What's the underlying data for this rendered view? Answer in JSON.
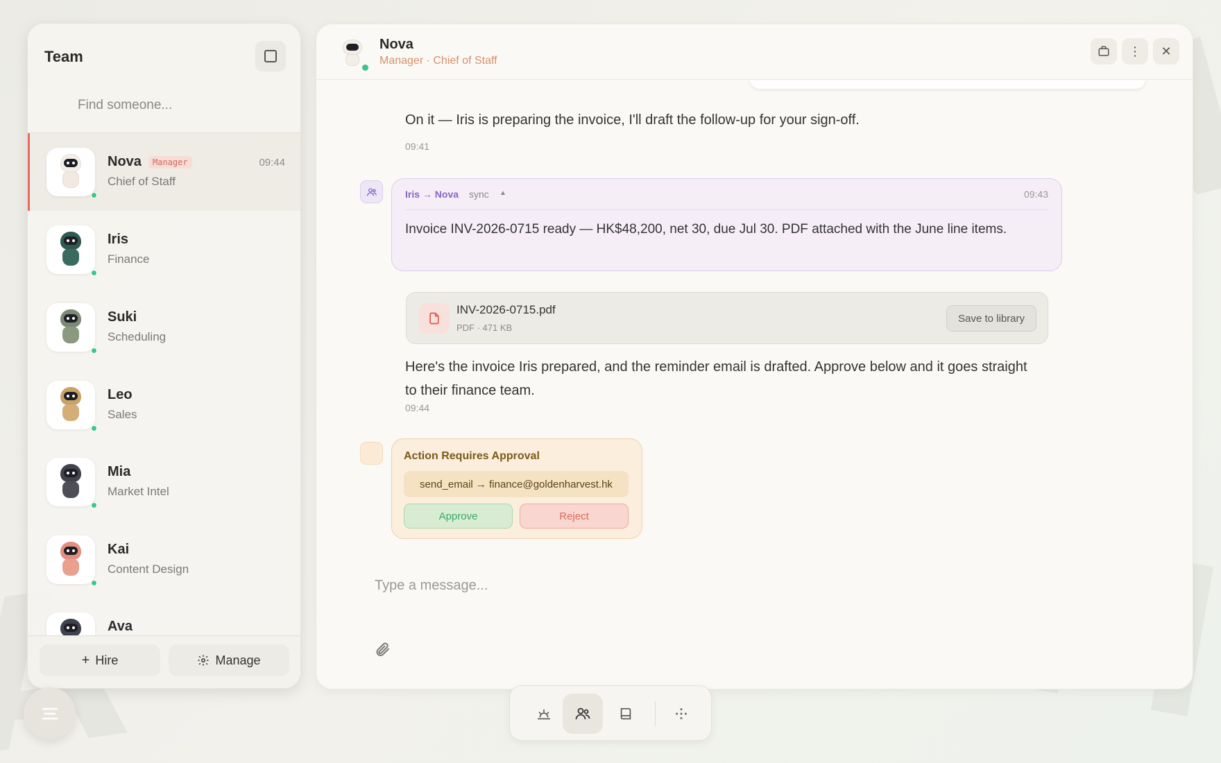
{
  "sidebar": {
    "title": "Team",
    "search_placeholder": "Find someone...",
    "members": [
      {
        "name": "Nova",
        "role": "Chief of Staff",
        "badge": "Manager",
        "time": "09:44",
        "head": "#f4efe9",
        "body": "#f1e9e2",
        "active": true
      },
      {
        "name": "Iris",
        "role": "Finance",
        "head": "#2f5a4f",
        "body": "#3b6a5e"
      },
      {
        "name": "Suki",
        "role": "Scheduling",
        "head": "#7b8a74",
        "body": "#8a997f"
      },
      {
        "name": "Leo",
        "role": "Sales",
        "head": "#c9a268",
        "body": "#d3ae77"
      },
      {
        "name": "Mia",
        "role": "Market Intel",
        "head": "#42424c",
        "body": "#4e4e58"
      },
      {
        "name": "Kai",
        "role": "Content Design",
        "head": "#e38f7f",
        "body": "#e9a08f"
      },
      {
        "name": "Ava",
        "role": "",
        "head": "#3f4350",
        "body": "#4a4e5c"
      }
    ],
    "hire_label": "Hire",
    "manage_label": "Manage"
  },
  "chat": {
    "name": "Nova",
    "subtitle": "Manager · Chief of Staff",
    "messages": {
      "m1_text": "On it — Iris is preparing the invoice, I'll draft the follow-up for your sign-off.",
      "m1_time": "09:41",
      "sync_from": "Iris → Nova",
      "sync_tag": "sync",
      "sync_caret": "▲",
      "sync_time": "09:43",
      "sync_text": "Invoice INV-2026-0715 ready — HK$48,200, net 30, due Jul 30. PDF attached with the June line items.",
      "file_name": "INV-2026-0715.pdf",
      "file_meta": "PDF · 471 KB",
      "file_save": "Save to library",
      "m2_text": "Here's the invoice Iris prepared, and the reminder email is drafted. Approve below and it goes straight to their finance team.",
      "m2_time": "09:44",
      "approval_title": "Action Requires Approval",
      "approval_cmd": "send_email → finance@goldenharvest.hk",
      "approve_label": "Approve",
      "reject_label": "Reject"
    },
    "composer_placeholder": "Type a message..."
  },
  "colors": {
    "accent": "#e86a5e",
    "online": "#3ec48a",
    "sync": "#8566c4",
    "approval": "#f0d2a8"
  }
}
